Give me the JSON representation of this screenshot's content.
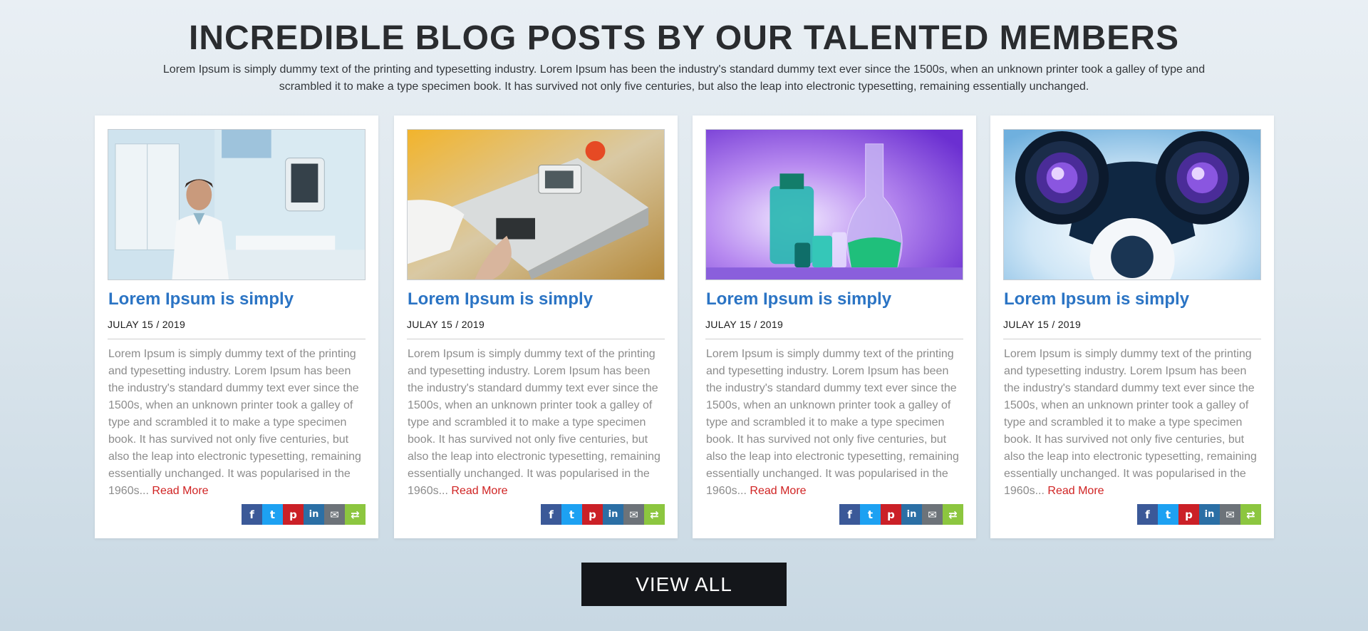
{
  "header": {
    "title": "INCREDIBLE BLOG POSTS BY OUR TALENTED MEMBERS",
    "intro": "Lorem Ipsum is simply dummy text of the printing and typesetting industry. Lorem Ipsum has been the industry's standard dummy text ever since the 1500s, when an unknown printer took a galley of type and scrambled it to make a type specimen book. It has survived not only five centuries, but also the leap into electronic typesetting, remaining essentially unchanged."
  },
  "posts": [
    {
      "image": "doctor-at-ultrasound-machine",
      "title": "Lorem Ipsum is simply",
      "date": "JULAY 15 / 2019",
      "excerpt": "Lorem Ipsum is simply dummy text of the printing and typesetting industry. Lorem Ipsum has been the industry's standard dummy text ever since the 1500s, when an unknown printer took a galley of type and scrambled it to make a type specimen book. It has survived not only five centuries, but also the leap into electronic typesetting, remaining essentially unchanged. It was popularised in the 1960s...",
      "read_more": "Read More"
    },
    {
      "image": "lab-analyzer-keypad",
      "title": "Lorem Ipsum is simply",
      "date": "JULAY 15 / 2019",
      "excerpt": "Lorem Ipsum is simply dummy text of the printing and typesetting industry. Lorem Ipsum has been the industry's standard dummy text ever since the 1500s, when an unknown printer took a galley of type and scrambled it to make a type specimen book. It has survived not only five centuries, but also the leap into electronic typesetting, remaining essentially unchanged. It was popularised in the 1960s...",
      "read_more": "Read More"
    },
    {
      "image": "lab-glassware-purple",
      "title": "Lorem Ipsum is simply",
      "date": "JULAY 15 / 2019",
      "excerpt": "Lorem Ipsum is simply dummy text of the printing and typesetting industry. Lorem Ipsum has been the industry's standard dummy text ever since the 1500s, when an unknown printer took a galley of type and scrambled it to make a type specimen book. It has survived not only five centuries, but also the leap into electronic typesetting, remaining essentially unchanged. It was popularised in the 1960s...",
      "read_more": "Read More"
    },
    {
      "image": "microscope-eyepieces",
      "title": "Lorem Ipsum is simply",
      "date": "JULAY 15 / 2019",
      "excerpt": "Lorem Ipsum is simply dummy text of the printing and typesetting industry. Lorem Ipsum has been the industry's standard dummy text ever since the 1500s, when an unknown printer took a galley of type and scrambled it to make a type specimen book. It has survived not only five centuries, but also the leap into electronic typesetting, remaining essentially unchanged. It was popularised in the 1960s...",
      "read_more": "Read More"
    }
  ],
  "share_buttons": [
    {
      "icon": "facebook-icon",
      "glyph": "f",
      "color": "#3b5998"
    },
    {
      "icon": "twitter-icon",
      "glyph": "t",
      "color": "#1da1f2"
    },
    {
      "icon": "pinterest-icon",
      "glyph": "p",
      "color": "#cb2027"
    },
    {
      "icon": "linkedin-icon",
      "glyph": "in",
      "color": "#2b6fa5"
    },
    {
      "icon": "email-icon",
      "glyph": "✉",
      "color": "#6d7379"
    },
    {
      "icon": "share-icon",
      "glyph": "⇄",
      "color": "#8cc63f"
    }
  ],
  "view_all_label": "VIEW ALL",
  "colors": {
    "title_blue": "#2b74c4",
    "read_more_red": "#d02323",
    "button_dark": "#14161a"
  }
}
